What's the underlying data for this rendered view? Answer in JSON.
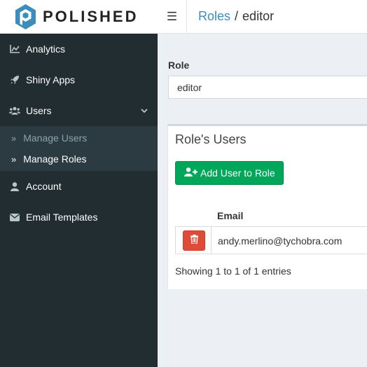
{
  "app": {
    "logo_text": "POLISHED",
    "colors": {
      "sidebar": "#222d32",
      "submenu": "#2c3b41",
      "accent": "#3c8dbc",
      "success": "#00a65a",
      "danger": "#dd4b39"
    }
  },
  "header": {
    "menu_icon": "hamburger-icon",
    "breadcrumb": {
      "link": "Roles",
      "separator": "/",
      "current": "editor"
    }
  },
  "sidebar": {
    "items": [
      {
        "label": "Analytics",
        "icon": "chart-icon"
      },
      {
        "label": "Shiny Apps",
        "icon": "rocket-icon"
      },
      {
        "label": "Users",
        "icon": "users-icon",
        "expanded": true,
        "children": [
          {
            "label": "Manage Users",
            "icon": "double-chevron-icon",
            "active": false
          },
          {
            "label": "Manage Roles",
            "icon": "double-chevron-icon",
            "active": true
          }
        ]
      },
      {
        "label": "Account",
        "icon": "user-icon"
      },
      {
        "label": "Email Templates",
        "icon": "envelope-icon"
      }
    ]
  },
  "main": {
    "role_label": "Role",
    "role_value": "editor",
    "box": {
      "title": "Role's Users",
      "add_button_label": "Add User to Role",
      "table": {
        "columns": [
          "",
          "Email"
        ],
        "rows": [
          {
            "email": "andy.merlino@tychobra.com"
          }
        ]
      },
      "info": "Showing 1 to 1 of 1 entries"
    }
  }
}
